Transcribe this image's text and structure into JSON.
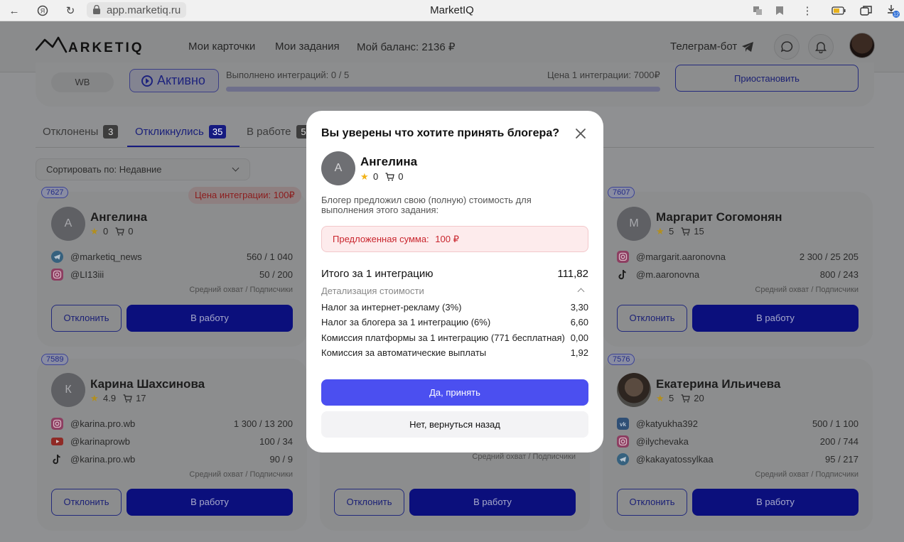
{
  "browser": {
    "url": "app.marketiq.ru",
    "title": "MarketIQ",
    "download_badge": "12"
  },
  "header": {
    "logo_text": "MARKETIQ",
    "nav": [
      "Мои карточки",
      "Мои задания",
      "Мой баланс: 2136 ₽"
    ],
    "telegram": "Телеграм-бот"
  },
  "task": {
    "marketplace": "WB",
    "status": "Активно",
    "progress_text": "Выполнено интеграций: 0 / 5",
    "progress_fraction": 0,
    "price_text": "Цена 1 интеграции: 7000₽",
    "pause_label": "Приостановить"
  },
  "tabs": [
    {
      "label": "Отклонены",
      "count": "3"
    },
    {
      "label": "Откликнулись",
      "count": "35"
    },
    {
      "label": "В работе",
      "count": "5"
    }
  ],
  "sort": {
    "label": "Сортировать по: Недавние"
  },
  "reach_note": "Средний охват / Подписчики",
  "decline_label": "Отклонить",
  "work_label": "В работу",
  "cards": [
    {
      "id": "7627",
      "price_chip": "Цена интеграции: 100₽",
      "initial": "А",
      "name": "Ангелина",
      "rating": "0",
      "orders": "0",
      "socials": [
        {
          "icon": "telegram-icon",
          "handle": "@marketiq_news",
          "nums": "560  /  1 040"
        },
        {
          "icon": "instagram-icon",
          "handle": "@LI13iii",
          "nums": "50  /  200"
        }
      ]
    },
    {
      "id": "7607",
      "initial": "М",
      "name": "Маргарит Согомонян",
      "rating": "5",
      "orders": "15",
      "socials": [
        {
          "icon": "instagram-icon",
          "handle": "@margarit.aaronovna",
          "nums": "2 300  /  25 205"
        },
        {
          "icon": "tiktok-icon",
          "handle": "@m.aaronovna",
          "nums": "800  /  243"
        }
      ]
    },
    {
      "id": "7589",
      "initial": "К",
      "name": "Карина Шахсинова",
      "rating": "4.9",
      "orders": "17",
      "socials": [
        {
          "icon": "instagram-icon",
          "handle": "@karina.pro.wb",
          "nums": "1 300  /  13 200"
        },
        {
          "icon": "youtube-icon",
          "handle": "@karinaprowb",
          "nums": "100  /  34"
        },
        {
          "icon": "tiktok-icon",
          "handle": "@karina.pro.wb",
          "nums": "90  /  9"
        }
      ]
    },
    {
      "id": "7576",
      "name": "Екатерина Ильичева",
      "rating": "5",
      "orders": "20",
      "socials": [
        {
          "icon": "vk-icon",
          "handle": "@katyukha392",
          "nums": "500  /  1 100"
        },
        {
          "icon": "instagram-icon",
          "handle": "@ilychevaka",
          "nums": "200  /  744"
        },
        {
          "icon": "telegram-icon",
          "handle": "@kakayatossylkaa",
          "nums": "95  /  217"
        }
      ]
    }
  ],
  "modal": {
    "title": "Вы уверены что хотите принять блогера?",
    "blogger_initial": "А",
    "blogger_name": "Ангелина",
    "rating": "0",
    "orders": "0",
    "description": "Блогер предложил свою (полную) стоимость для выполнения этого задания:",
    "offer_label": "Предложенная сумма:",
    "offer_value": "100 ₽",
    "total_label": "Итого за 1 интеграцию",
    "total_value": "111,82",
    "detail_label": "Детализация стоимости",
    "lines": [
      {
        "label": "Налог за интернет-рекламу (3%)",
        "value": "3,30"
      },
      {
        "label": "Налог за блогера за 1 интеграцию (6%)",
        "value": "6,60"
      },
      {
        "label": "Комиссия платформы за 1 интеграцию (771 бесплатная)",
        "value": "0,00"
      },
      {
        "label": "Комиссия за автоматические выплаты",
        "value": "1,92"
      }
    ],
    "accept_label": "Да, принять",
    "back_label": "Нет, вернуться назад"
  }
}
